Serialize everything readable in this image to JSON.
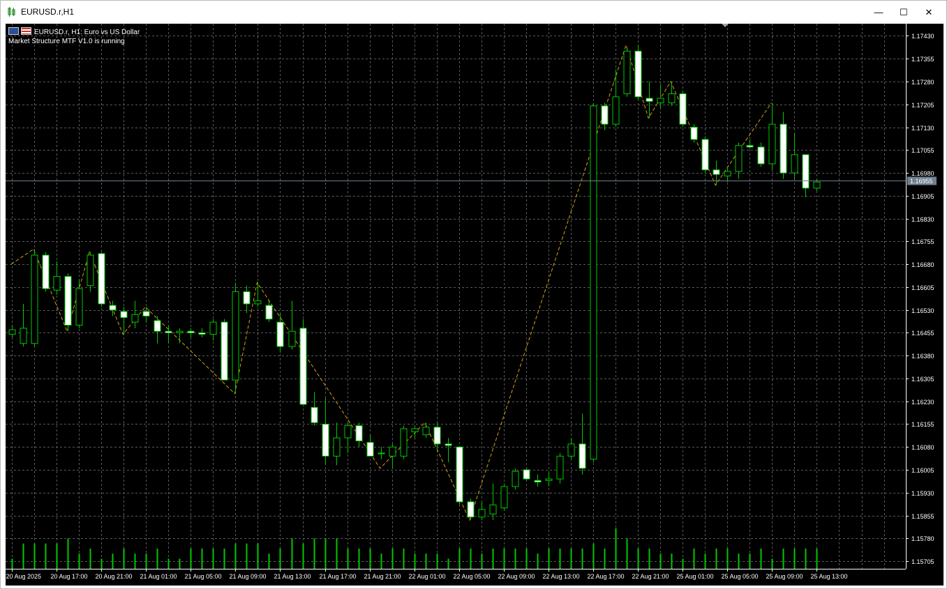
{
  "window": {
    "title": "EURUSD.r,H1",
    "minimize_glyph": "—",
    "maximize_glyph": "☐",
    "close_glyph": "✕"
  },
  "chart_header": {
    "symbol_line": "EURUSD.r, H1:  Euro vs US Dollar",
    "indicator_line": "Market Structure MTF V1.0 is running"
  },
  "colors": {
    "background": "#000000",
    "grid": "#5a5a5a",
    "bull_candle": "#00c800",
    "bear_candle_body": "#ffffff",
    "zigzag": "#d4a017",
    "volume": "#00c800",
    "bid_line": "#708090",
    "axis_text": "#ffffff"
  },
  "chart_data": {
    "type": "candlestick",
    "price_axis_labels": [
      "1.17430",
      "1.17355",
      "1.17280",
      "1.17205",
      "1.17130",
      "1.17055",
      "1.16980",
      "1.16905",
      "1.16830",
      "1.16755",
      "1.16680",
      "1.16605",
      "1.16530",
      "1.16455",
      "1.16380",
      "1.16305",
      "1.16230",
      "1.16155",
      "1.16080",
      "1.16005",
      "1.15930",
      "1.15855",
      "1.15780",
      "1.15705"
    ],
    "ylim": [
      1.1568,
      1.1747
    ],
    "current_price": "1.16955",
    "time_axis_labels": [
      "20 Aug 2025",
      "20 Aug 17:00",
      "20 Aug 21:00",
      "21 Aug 01:00",
      "21 Aug 05:00",
      "21 Aug 09:00",
      "21 Aug 13:00",
      "21 Aug 17:00",
      "21 Aug 21:00",
      "22 Aug 01:00",
      "22 Aug 05:00",
      "22 Aug 09:00",
      "22 Aug 13:00",
      "22 Aug 17:00",
      "22 Aug 21:00",
      "25 Aug 01:00",
      "25 Aug 05:00",
      "25 Aug 09:00",
      "25 Aug 13:00"
    ],
    "candles": [
      {
        "o": 1.1645,
        "h": 1.1648,
        "l": 1.1644,
        "c": 1.16465
      },
      {
        "o": 1.1642,
        "h": 1.1655,
        "l": 1.1641,
        "c": 1.1647
      },
      {
        "o": 1.1642,
        "h": 1.1673,
        "l": 1.1641,
        "c": 1.1671
      },
      {
        "o": 1.1671,
        "h": 1.1672,
        "l": 1.1659,
        "c": 1.166
      },
      {
        "o": 1.16595,
        "h": 1.1669,
        "l": 1.1658,
        "c": 1.1664
      },
      {
        "o": 1.1664,
        "h": 1.1665,
        "l": 1.1646,
        "c": 1.1648
      },
      {
        "o": 1.1648,
        "h": 1.1663,
        "l": 1.1647,
        "c": 1.166
      },
      {
        "o": 1.1661,
        "h": 1.1672,
        "l": 1.1659,
        "c": 1.1671
      },
      {
        "o": 1.16715,
        "h": 1.1672,
        "l": 1.1654,
        "c": 1.1655
      },
      {
        "o": 1.16545,
        "h": 1.1656,
        "l": 1.1651,
        "c": 1.1653
      },
      {
        "o": 1.16525,
        "h": 1.1654,
        "l": 1.1645,
        "c": 1.16505
      },
      {
        "o": 1.1649,
        "h": 1.1656,
        "l": 1.1647,
        "c": 1.16515
      },
      {
        "o": 1.16525,
        "h": 1.1654,
        "l": 1.1649,
        "c": 1.1651
      },
      {
        "o": 1.16495,
        "h": 1.1651,
        "l": 1.1642,
        "c": 1.1646
      },
      {
        "o": 1.1646,
        "h": 1.1648,
        "l": 1.1642,
        "c": 1.16455
      },
      {
        "o": 1.16455,
        "h": 1.1647,
        "l": 1.1642,
        "c": 1.1646
      },
      {
        "o": 1.1646,
        "h": 1.1647,
        "l": 1.1644,
        "c": 1.16455
      },
      {
        "o": 1.16455,
        "h": 1.1647,
        "l": 1.1644,
        "c": 1.1645
      },
      {
        "o": 1.1645,
        "h": 1.165,
        "l": 1.1643,
        "c": 1.1649
      },
      {
        "o": 1.1649,
        "h": 1.165,
        "l": 1.163,
        "c": 1.163
      },
      {
        "o": 1.163,
        "h": 1.1662,
        "l": 1.16255,
        "c": 1.1659
      },
      {
        "o": 1.1659,
        "h": 1.1661,
        "l": 1.1652,
        "c": 1.1655
      },
      {
        "o": 1.1655,
        "h": 1.1662,
        "l": 1.1654,
        "c": 1.1656
      },
      {
        "o": 1.16545,
        "h": 1.1656,
        "l": 1.1649,
        "c": 1.165
      },
      {
        "o": 1.1649,
        "h": 1.1652,
        "l": 1.1639,
        "c": 1.1641
      },
      {
        "o": 1.1641,
        "h": 1.1656,
        "l": 1.164,
        "c": 1.1646
      },
      {
        "o": 1.1647,
        "h": 1.165,
        "l": 1.1622,
        "c": 1.1622
      },
      {
        "o": 1.1621,
        "h": 1.1626,
        "l": 1.1615,
        "c": 1.1616
      },
      {
        "o": 1.16155,
        "h": 1.1624,
        "l": 1.1602,
        "c": 1.1605
      },
      {
        "o": 1.1605,
        "h": 1.1616,
        "l": 1.1602,
        "c": 1.1611
      },
      {
        "o": 1.1611,
        "h": 1.1616,
        "l": 1.1606,
        "c": 1.1615
      },
      {
        "o": 1.1615,
        "h": 1.1616,
        "l": 1.1608,
        "c": 1.161
      },
      {
        "o": 1.16095,
        "h": 1.1612,
        "l": 1.1605,
        "c": 1.1605
      },
      {
        "o": 1.1606,
        "h": 1.1608,
        "l": 1.1604,
        "c": 1.1606
      },
      {
        "o": 1.1605,
        "h": 1.1609,
        "l": 1.1601,
        "c": 1.1608
      },
      {
        "o": 1.1605,
        "h": 1.1615,
        "l": 1.1604,
        "c": 1.1614
      },
      {
        "o": 1.1613,
        "h": 1.1615,
        "l": 1.1611,
        "c": 1.1614
      },
      {
        "o": 1.1612,
        "h": 1.1616,
        "l": 1.1611,
        "c": 1.16145
      },
      {
        "o": 1.16145,
        "h": 1.1616,
        "l": 1.1607,
        "c": 1.1609
      },
      {
        "o": 1.1609,
        "h": 1.1611,
        "l": 1.1603,
        "c": 1.16085
      },
      {
        "o": 1.1608,
        "h": 1.1608,
        "l": 1.1589,
        "c": 1.159
      },
      {
        "o": 1.159,
        "h": 1.1591,
        "l": 1.1584,
        "c": 1.1585
      },
      {
        "o": 1.1585,
        "h": 1.159,
        "l": 1.1584,
        "c": 1.15875
      },
      {
        "o": 1.1586,
        "h": 1.1596,
        "l": 1.1584,
        "c": 1.1589
      },
      {
        "o": 1.1588,
        "h": 1.1596,
        "l": 1.1587,
        "c": 1.1595
      },
      {
        "o": 1.1595,
        "h": 1.1601,
        "l": 1.1594,
        "c": 1.16
      },
      {
        "o": 1.16005,
        "h": 1.1601,
        "l": 1.1597,
        "c": 1.15975
      },
      {
        "o": 1.1597,
        "h": 1.1599,
        "l": 1.1595,
        "c": 1.15965
      },
      {
        "o": 1.1597,
        "h": 1.16,
        "l": 1.1595,
        "c": 1.15975
      },
      {
        "o": 1.15975,
        "h": 1.1606,
        "l": 1.1596,
        "c": 1.1605
      },
      {
        "o": 1.1605,
        "h": 1.1611,
        "l": 1.1604,
        "c": 1.1609
      },
      {
        "o": 1.1609,
        "h": 1.1619,
        "l": 1.1599,
        "c": 1.1601
      },
      {
        "o": 1.1604,
        "h": 1.1721,
        "l": 1.1603,
        "c": 1.172
      },
      {
        "o": 1.172,
        "h": 1.1721,
        "l": 1.1712,
        "c": 1.1714
      },
      {
        "o": 1.1714,
        "h": 1.1732,
        "l": 1.1713,
        "c": 1.1723
      },
      {
        "o": 1.1724,
        "h": 1.1739,
        "l": 1.1723,
        "c": 1.1738
      },
      {
        "o": 1.1738,
        "h": 1.174,
        "l": 1.1722,
        "c": 1.1723
      },
      {
        "o": 1.17225,
        "h": 1.1728,
        "l": 1.1716,
        "c": 1.17215
      },
      {
        "o": 1.1721,
        "h": 1.1727,
        "l": 1.1719,
        "c": 1.17225
      },
      {
        "o": 1.1721,
        "h": 1.1728,
        "l": 1.172,
        "c": 1.1724
      },
      {
        "o": 1.1724,
        "h": 1.1725,
        "l": 1.1713,
        "c": 1.1714
      },
      {
        "o": 1.1713,
        "h": 1.1714,
        "l": 1.1708,
        "c": 1.1709
      },
      {
        "o": 1.1709,
        "h": 1.171,
        "l": 1.1698,
        "c": 1.1699
      },
      {
        "o": 1.1699,
        "h": 1.1702,
        "l": 1.1694,
        "c": 1.16975
      },
      {
        "o": 1.1697,
        "h": 1.17,
        "l": 1.1695,
        "c": 1.16985
      },
      {
        "o": 1.16985,
        "h": 1.1708,
        "l": 1.1696,
        "c": 1.1707
      },
      {
        "o": 1.1707,
        "h": 1.1709,
        "l": 1.1706,
        "c": 1.17065
      },
      {
        "o": 1.17065,
        "h": 1.1708,
        "l": 1.17,
        "c": 1.1701
      },
      {
        "o": 1.1701,
        "h": 1.1721,
        "l": 1.1699,
        "c": 1.1714
      },
      {
        "o": 1.1714,
        "h": 1.1718,
        "l": 1.1696,
        "c": 1.1698
      },
      {
        "o": 1.1698,
        "h": 1.1711,
        "l": 1.1696,
        "c": 1.1704
      },
      {
        "o": 1.1704,
        "h": 1.1704,
        "l": 1.169,
        "c": 1.1693
      },
      {
        "o": 1.1693,
        "h": 1.1696,
        "l": 1.1692,
        "c": 1.1695
      }
    ],
    "volumes": [
      2,
      5,
      5,
      5,
      5,
      6,
      3,
      4,
      2,
      3,
      4,
      3,
      3,
      4,
      2,
      2,
      4,
      4,
      4,
      4,
      5,
      5,
      5,
      3,
      4,
      6,
      5,
      6,
      6,
      6,
      4,
      4,
      4,
      3,
      4,
      4,
      3,
      3,
      3,
      2,
      4,
      4,
      3,
      4,
      4,
      4,
      4,
      3,
      4,
      4,
      4,
      4,
      5,
      4,
      8,
      6,
      4,
      4,
      3,
      3,
      2,
      4,
      3,
      4,
      4,
      3,
      3,
      4,
      2,
      4,
      4,
      4,
      4
    ],
    "zigzag": [
      [
        0,
        1.1668
      ],
      [
        2,
        1.1673
      ],
      [
        5,
        1.1646
      ],
      [
        7,
        1.1672
      ],
      [
        10,
        1.1645
      ],
      [
        12,
        1.1654
      ],
      [
        20,
        1.16255
      ],
      [
        22,
        1.1662
      ],
      [
        33,
        1.1601
      ],
      [
        37,
        1.1616
      ],
      [
        41,
        1.1584
      ],
      [
        55,
        1.174
      ],
      [
        57,
        1.1716
      ],
      [
        59,
        1.1728
      ],
      [
        63,
        1.1694
      ],
      [
        68,
        1.1721
      ]
    ],
    "grid": true
  }
}
